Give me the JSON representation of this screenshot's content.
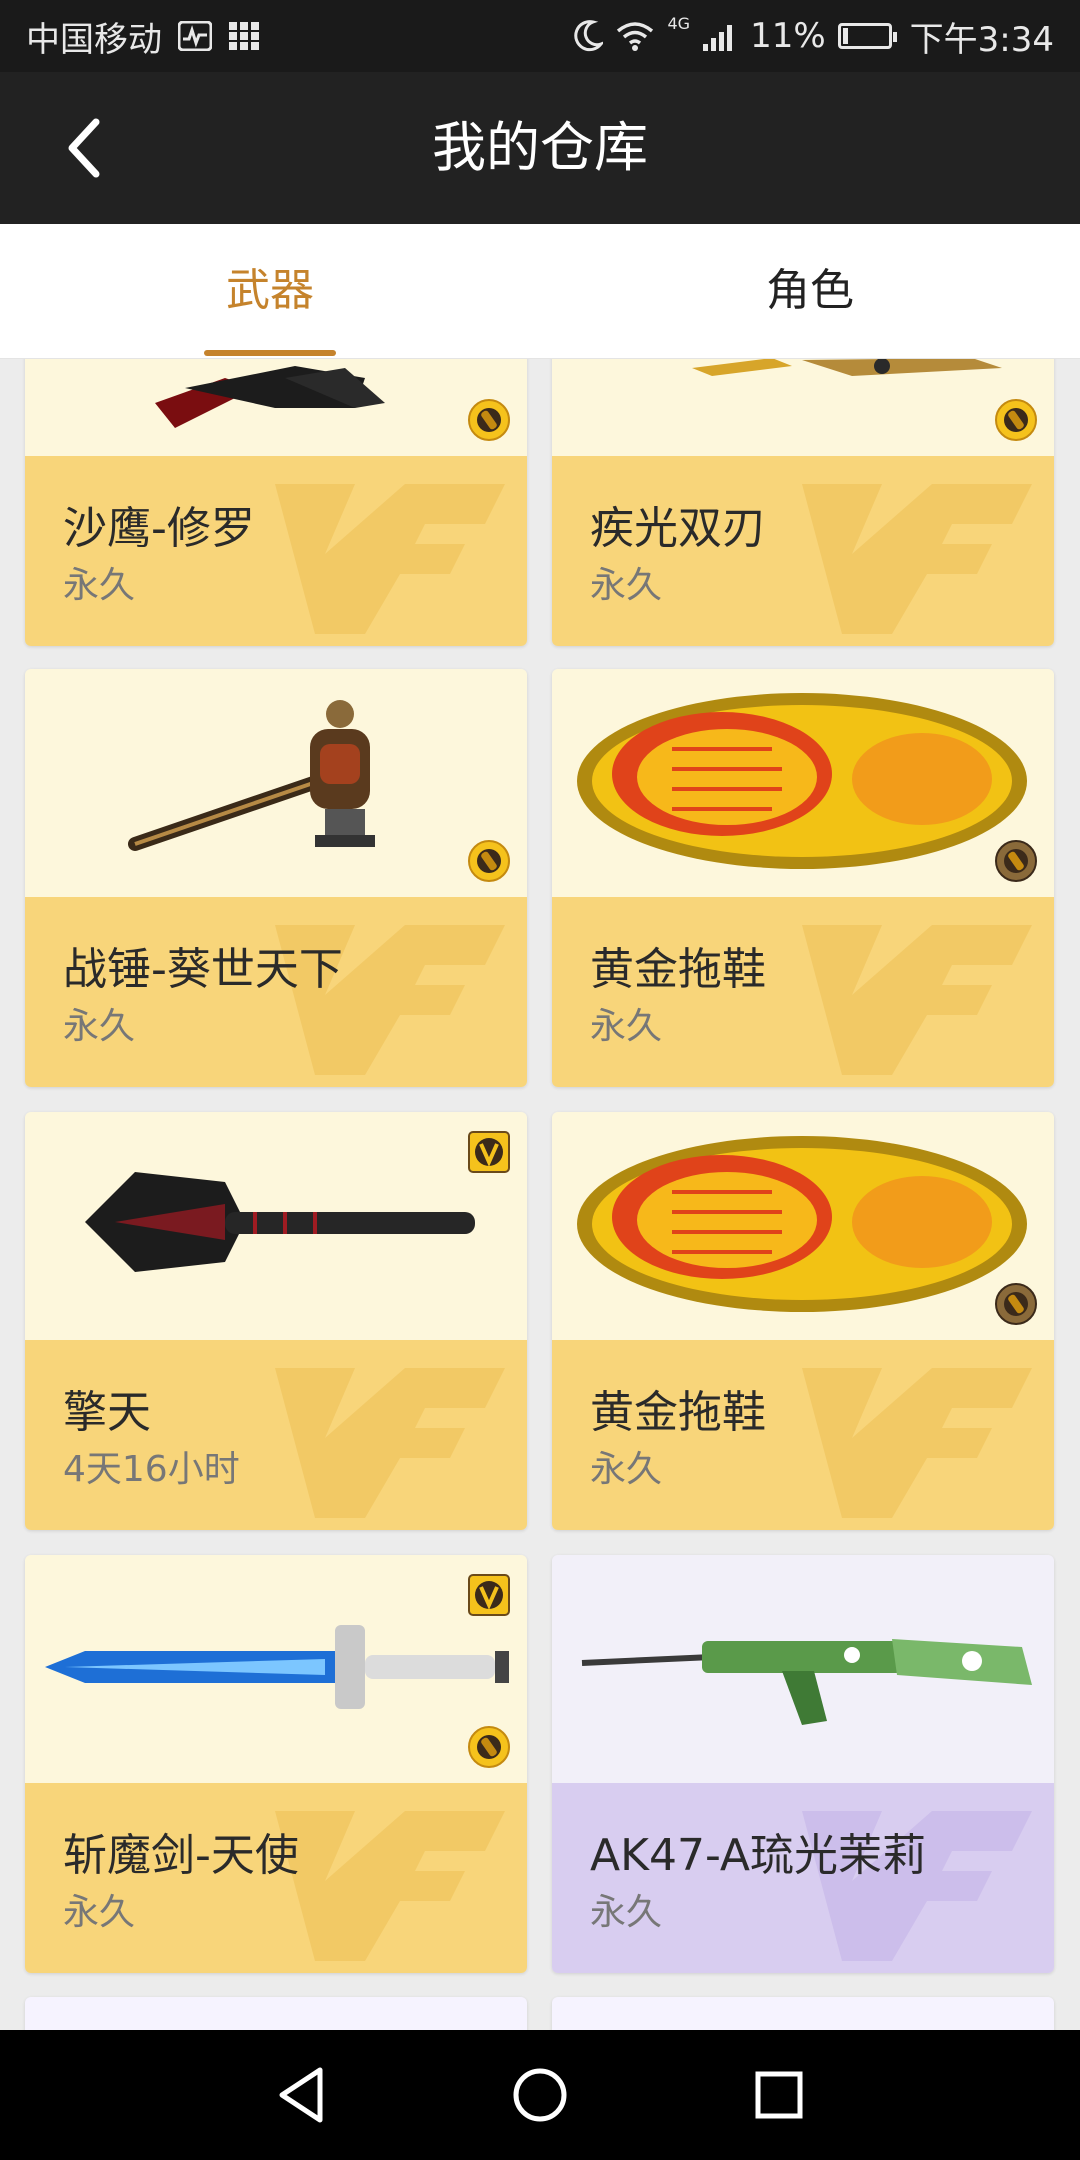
{
  "status_bar": {
    "carrier": "中国移动",
    "network": "4G",
    "battery": "11%",
    "battery_level": 0.11,
    "time": "下午3:34"
  },
  "header": {
    "title": "我的仓库"
  },
  "tabs": [
    {
      "label": "武器",
      "active": true
    },
    {
      "label": "角色",
      "active": false
    }
  ],
  "items": [
    {
      "name": "沙鹰-修罗",
      "duration": "永久",
      "image": "pistol-image",
      "badge": "coin"
    },
    {
      "name": "疾光双刃",
      "duration": "永久",
      "image": "blade-image",
      "badge": "coin"
    },
    {
      "name": "战锤-葵世天下",
      "duration": "永久",
      "image": "warhammer-image",
      "badge": "coin"
    },
    {
      "name": "黄金拖鞋",
      "duration": "永久",
      "image": "golden-slipper-image",
      "badge": "coin"
    },
    {
      "name": "擎天",
      "duration": "4天16小时",
      "image": "shovel-image",
      "badge": "v"
    },
    {
      "name": "黄金拖鞋",
      "duration": "永久",
      "image": "golden-slipper-image",
      "badge": "coin"
    },
    {
      "name": "斩魔剑-天使",
      "duration": "永久",
      "image": "sword-image",
      "badge": "v+coin"
    },
    {
      "name": "AK47-A琉光茉莉",
      "duration": "永久",
      "image": "ak47-image",
      "badge": "none",
      "theme": "purple"
    }
  ],
  "colors": {
    "accent": "#c5832c",
    "card_info": "#f8d57a",
    "card_image": "#fdf7dc",
    "card_purple_info": "#d8cdf0",
    "header_bg": "#222222"
  },
  "icons": [
    "back-arrow-icon",
    "coin-icon",
    "v-badge-icon",
    "nav-back-icon",
    "nav-home-icon",
    "nav-recents-icon"
  ]
}
